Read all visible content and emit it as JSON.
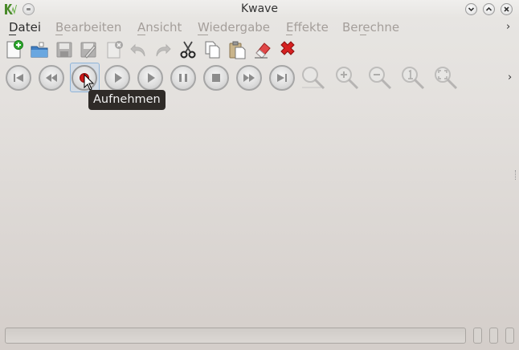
{
  "window": {
    "title": "Kwave",
    "controls": [
      "minimize",
      "maximize",
      "close"
    ]
  },
  "menubar": {
    "items": [
      {
        "label": "Datei",
        "enabled": true
      },
      {
        "label": "Bearbeiten",
        "enabled": false
      },
      {
        "label": "Ansicht",
        "enabled": false
      },
      {
        "label": "Wiedergabe",
        "enabled": false
      },
      {
        "label": "Effekte",
        "enabled": false
      },
      {
        "label": "Berechne",
        "enabled": false
      }
    ],
    "overflow": "›"
  },
  "toolbar_file": {
    "buttons": [
      "new-file",
      "open-file",
      "save",
      "save-as",
      "close-file",
      "undo",
      "redo",
      "cut",
      "copy",
      "paste",
      "erase",
      "delete"
    ]
  },
  "toolbar_playback": {
    "buttons": [
      "skip-to-start",
      "rewind",
      "record",
      "play",
      "play-loop",
      "pause",
      "stop",
      "fast-forward",
      "skip-to-end",
      "zoom-to-selection",
      "zoom-in",
      "zoom-out",
      "zoom-original",
      "zoom-all"
    ],
    "overflow": "›"
  },
  "tooltip": {
    "text": "Aufnehmen"
  },
  "colors": {
    "accent_blue": "#8fb4d8",
    "record_red": "#d01818",
    "tooltip_bg": "#2f2b28",
    "delete_red": "#d62020",
    "add_green": "#2ea82e"
  }
}
